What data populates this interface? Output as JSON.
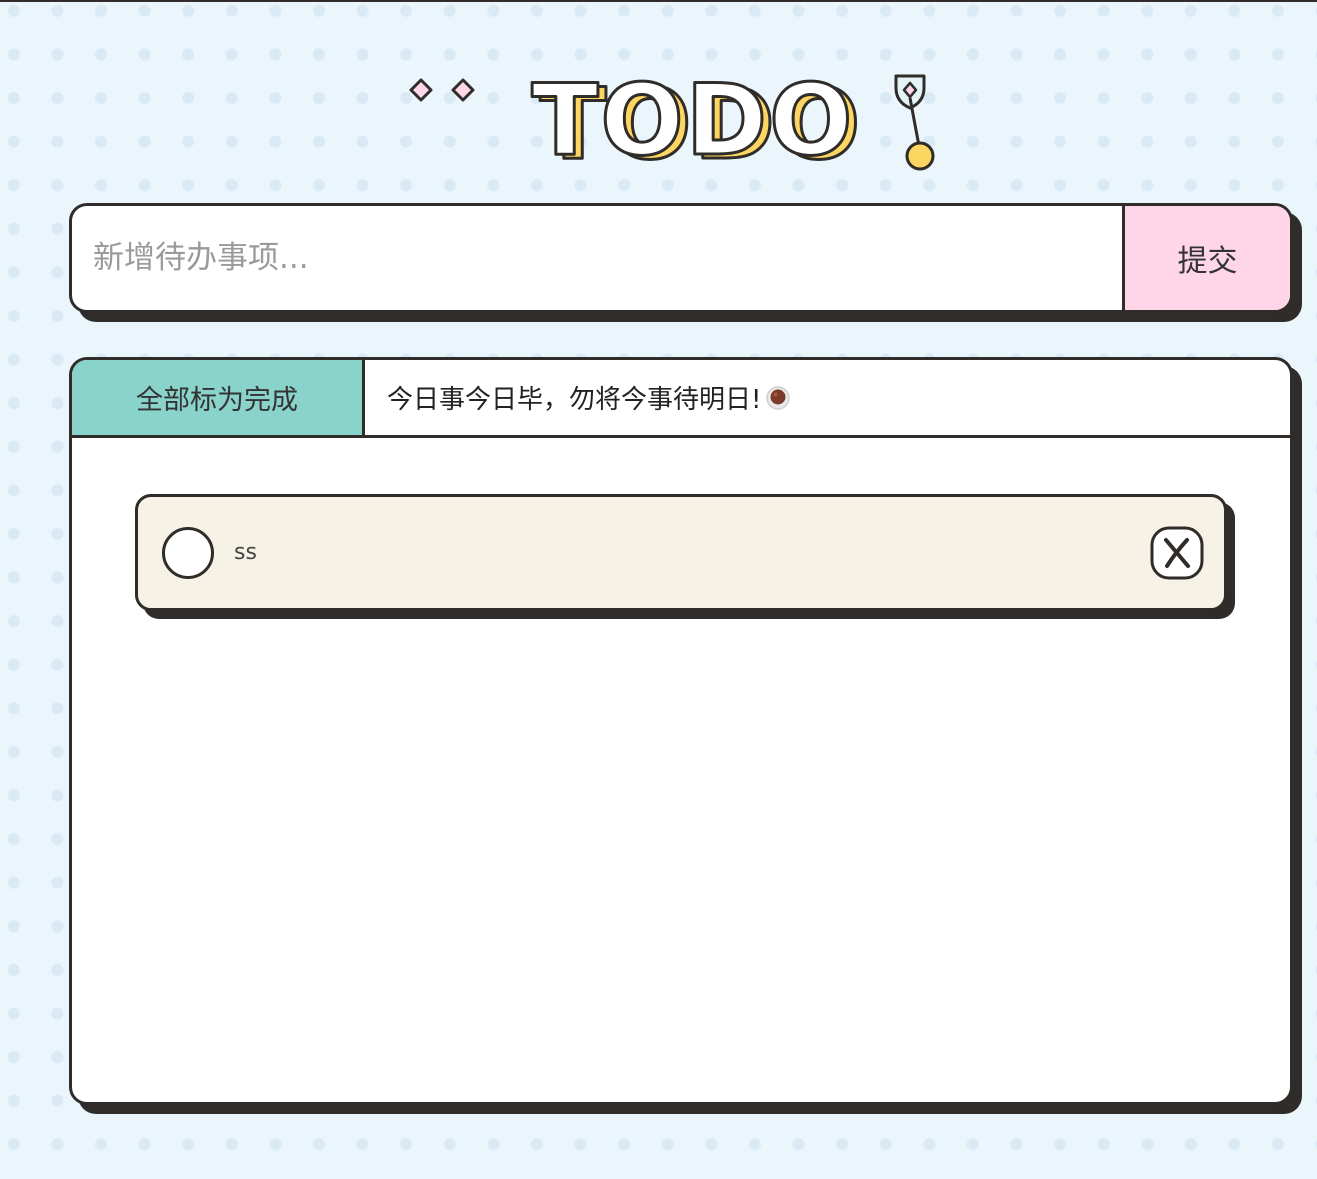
{
  "app": {
    "title": "TODO"
  },
  "new_todo": {
    "placeholder": "新增待办事项...",
    "value": "",
    "submit_label": "提交"
  },
  "list_header": {
    "mark_all_label": "全部标为完成",
    "motto": "今日事今日毕，勿将今事待明日!"
  },
  "todos": [
    {
      "text": "ss",
      "completed": false
    }
  ],
  "icons": {
    "logo_sparkles": "diamond-sparkle-icon",
    "logo_pendulum": "pendulum-icon",
    "motto_emoji": "coffee-icon",
    "check": "circle-check-icon",
    "delete": "close-icon"
  },
  "colors": {
    "background": "#eaf5fc",
    "outline": "#2f2c29",
    "submit_button": "#fed6e7",
    "mark_all_button": "#8ad3cb",
    "todo_item": "#f7f2e6",
    "logo_shadow": "#fcd661",
    "sparkle": "#fed6e7"
  }
}
